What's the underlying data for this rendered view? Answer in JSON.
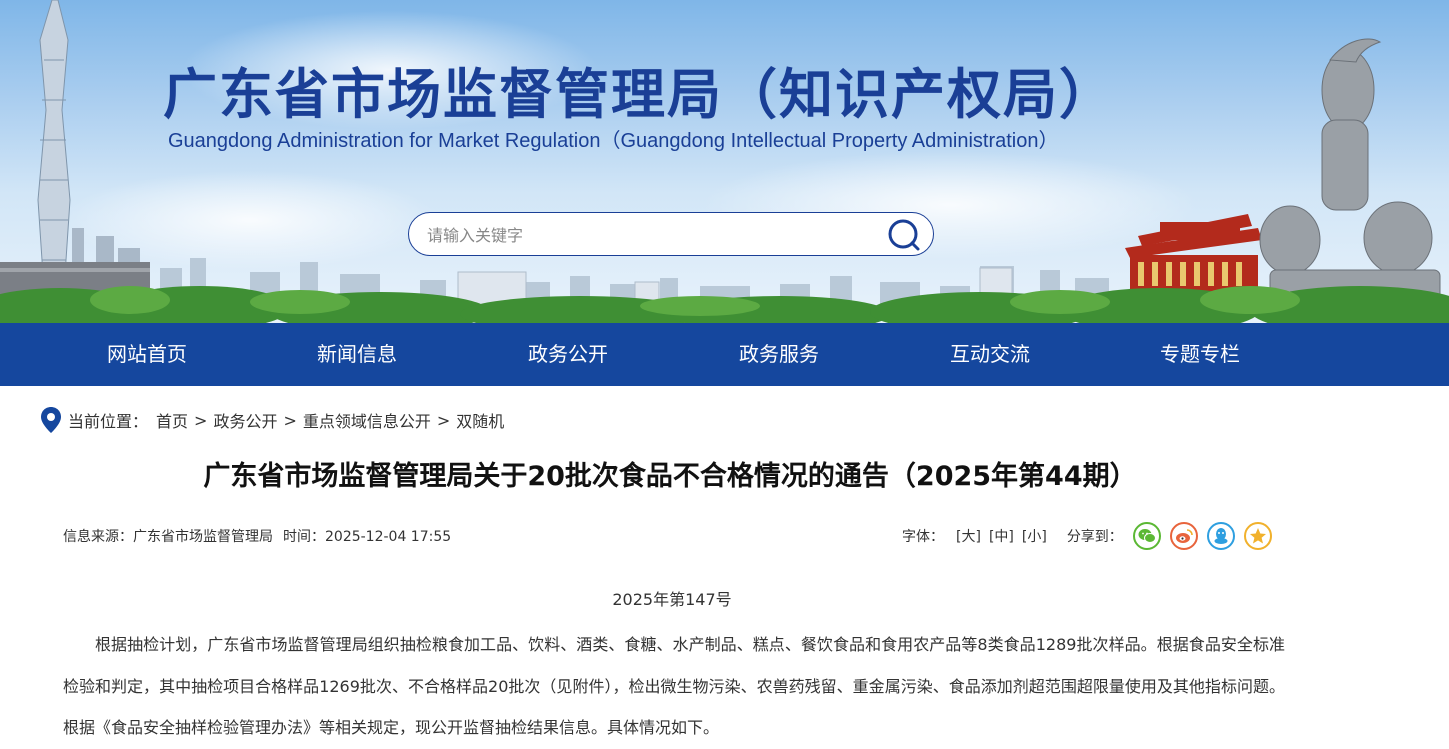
{
  "header": {
    "title": "广东省市场监督管理局（知识产权局）",
    "subtitle": "Guangdong Administration for Market Regulation（Guangdong Intellectual Property Administration）"
  },
  "search": {
    "placeholder": "请输入关键字",
    "icon": "search-icon"
  },
  "nav": {
    "items": [
      {
        "label": "网站首页"
      },
      {
        "label": "新闻信息"
      },
      {
        "label": "政务公开"
      },
      {
        "label": "政务服务"
      },
      {
        "label": "互动交流"
      },
      {
        "label": "专题专栏"
      }
    ],
    "background": "#15479e"
  },
  "breadcrumb": {
    "prefix": "当前位置：",
    "items": [
      "首页",
      "政务公开",
      "重点领域信息公开",
      "双随机"
    ],
    "separator": ">"
  },
  "article": {
    "title": "广东省市场监督管理局关于20批次食品不合格情况的通告（2025年第44期）",
    "source_label": "信息来源：",
    "source": "广东省市场监督管理局",
    "time_label": "时间：",
    "time": "2025-12-04 17:55",
    "font_size_label": "字体：",
    "font_sizes": [
      "[大]",
      "[中]",
      "[小]"
    ],
    "share_label": "分享到：",
    "share_icons": [
      {
        "name": "wechat-icon",
        "color": "#5bb834"
      },
      {
        "name": "weibo-icon",
        "color": "#e8643c"
      },
      {
        "name": "qq-icon",
        "color": "#2e9fe0"
      },
      {
        "name": "qzone-star-icon",
        "color": "#f1b12c"
      }
    ],
    "doc_number": "2025年第147号",
    "body": "根据抽检计划，广东省市场监督管理局组织抽检粮食加工品、饮料、酒类、食糖、水产制品、糕点、餐饮食品和食用农产品等8类食品1289批次样品。根据食品安全标准检验和判定，其中抽检项目合格样品1269批次、不合格样品20批次（见附件），检出微生物污染、农兽药残留、重金属污染、食品添加剂超范围超限量使用及其他指标问题。根据《食品安全抽样检验管理办法》等相关规定，现公开监督抽检结果信息。具体情况如下。"
  },
  "colors": {
    "brand_blue": "#1a3f96",
    "nav_blue": "#15479e"
  }
}
